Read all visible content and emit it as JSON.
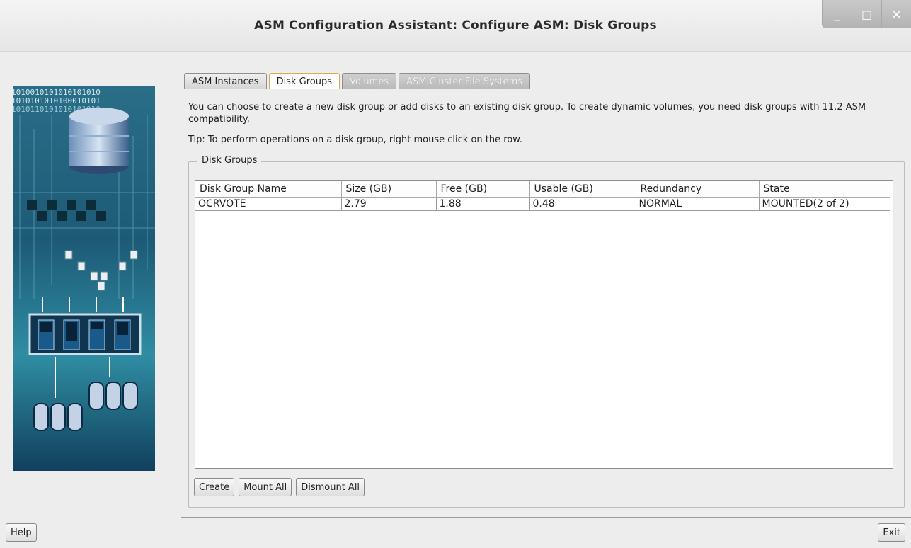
{
  "window": {
    "title": "ASM Configuration Assistant: Configure ASM: Disk Groups",
    "controls": [
      "_",
      "□",
      "×"
    ]
  },
  "side_art": {
    "binary_rows": [
      "1010010101010101010",
      "1010101010100010101",
      "1010110101010101010"
    ]
  },
  "tabs": [
    {
      "label": "ASM Instances",
      "state": "enabled"
    },
    {
      "label": "Disk Groups",
      "state": "active"
    },
    {
      "label": "Volumes",
      "state": "disabled"
    },
    {
      "label": "ASM Cluster File Systems",
      "state": "disabled"
    }
  ],
  "main": {
    "description": "You can choose to create a new disk group or add disks to an existing disk group. To create dynamic volumes, you need disk groups with 11.2 ASM compatibility.",
    "tip": "Tip: To perform operations on a disk group, right mouse click on the row.",
    "group_title": "Disk Groups",
    "table": {
      "columns": [
        "Disk Group Name",
        "Size (GB)",
        "Free (GB)",
        "Usable (GB)",
        "Redundancy",
        "State"
      ],
      "rows": [
        [
          "OCRVOTE",
          "2.79",
          "1.88",
          "0.48",
          "NORMAL",
          "MOUNTED(2 of 2)"
        ]
      ]
    },
    "buttons": {
      "create": "Create",
      "mount_all": "Mount All",
      "dismount_all": "Dismount All"
    }
  },
  "footer": {
    "help": "Help",
    "exit": "Exit"
  }
}
